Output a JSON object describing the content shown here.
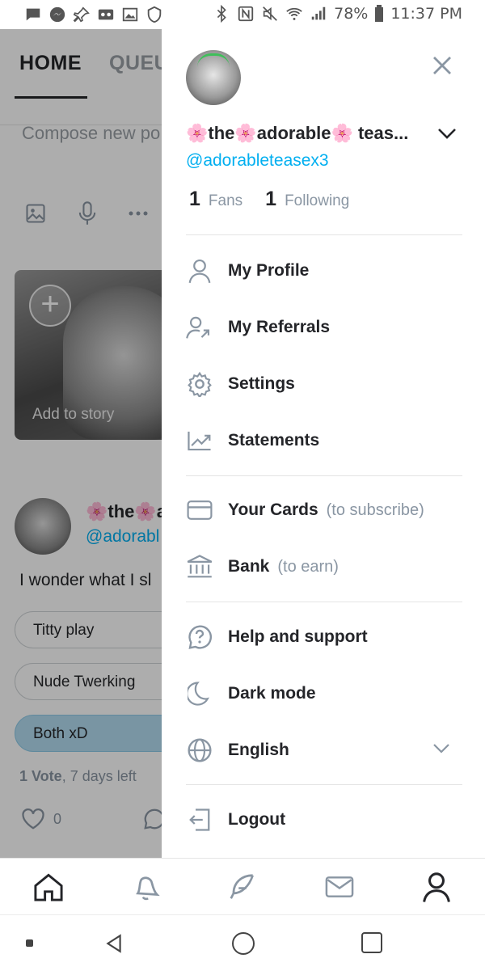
{
  "status_bar": {
    "battery": "78%",
    "time": "11:37 PM"
  },
  "feed": {
    "tabs": [
      {
        "label": "HOME"
      },
      {
        "label": "QUEU"
      }
    ],
    "compose_placeholder": "Compose new po",
    "story_label": "Add to story",
    "post": {
      "author": "🌸the🌸a",
      "handle": "@adorabl",
      "text": "I wonder what I sl",
      "poll_options": [
        {
          "label": "Titty play",
          "selected": false
        },
        {
          "label": "Nude Twerking",
          "selected": false
        },
        {
          "label": "Both xD",
          "selected": true
        }
      ],
      "poll_votes": "1 Vote",
      "poll_time": ", 7 days left",
      "likes": "0"
    }
  },
  "drawer": {
    "display_name": "🌸the🌸adorable🌸 teas...",
    "handle": "@adorableteasex3",
    "fans_count": "1",
    "fans_label": "Fans",
    "following_count": "1",
    "following_label": "Following",
    "menu": {
      "my_profile": "My Profile",
      "my_referrals": "My Referrals",
      "settings": "Settings",
      "statements": "Statements",
      "your_cards": "Your Cards",
      "your_cards_sub": "(to subscribe)",
      "bank": "Bank",
      "bank_sub": "(to earn)",
      "help": "Help and support",
      "dark_mode": "Dark mode",
      "language": "English",
      "logout": "Logout"
    }
  },
  "bottom_nav": [
    "home-icon",
    "bell-icon",
    "feather-icon",
    "envelope-icon",
    "user-icon"
  ],
  "colors": {
    "accent": "#00aff0",
    "muted": "#8a96a3",
    "text": "#242529",
    "poll_selected": "#b3dcf0"
  }
}
